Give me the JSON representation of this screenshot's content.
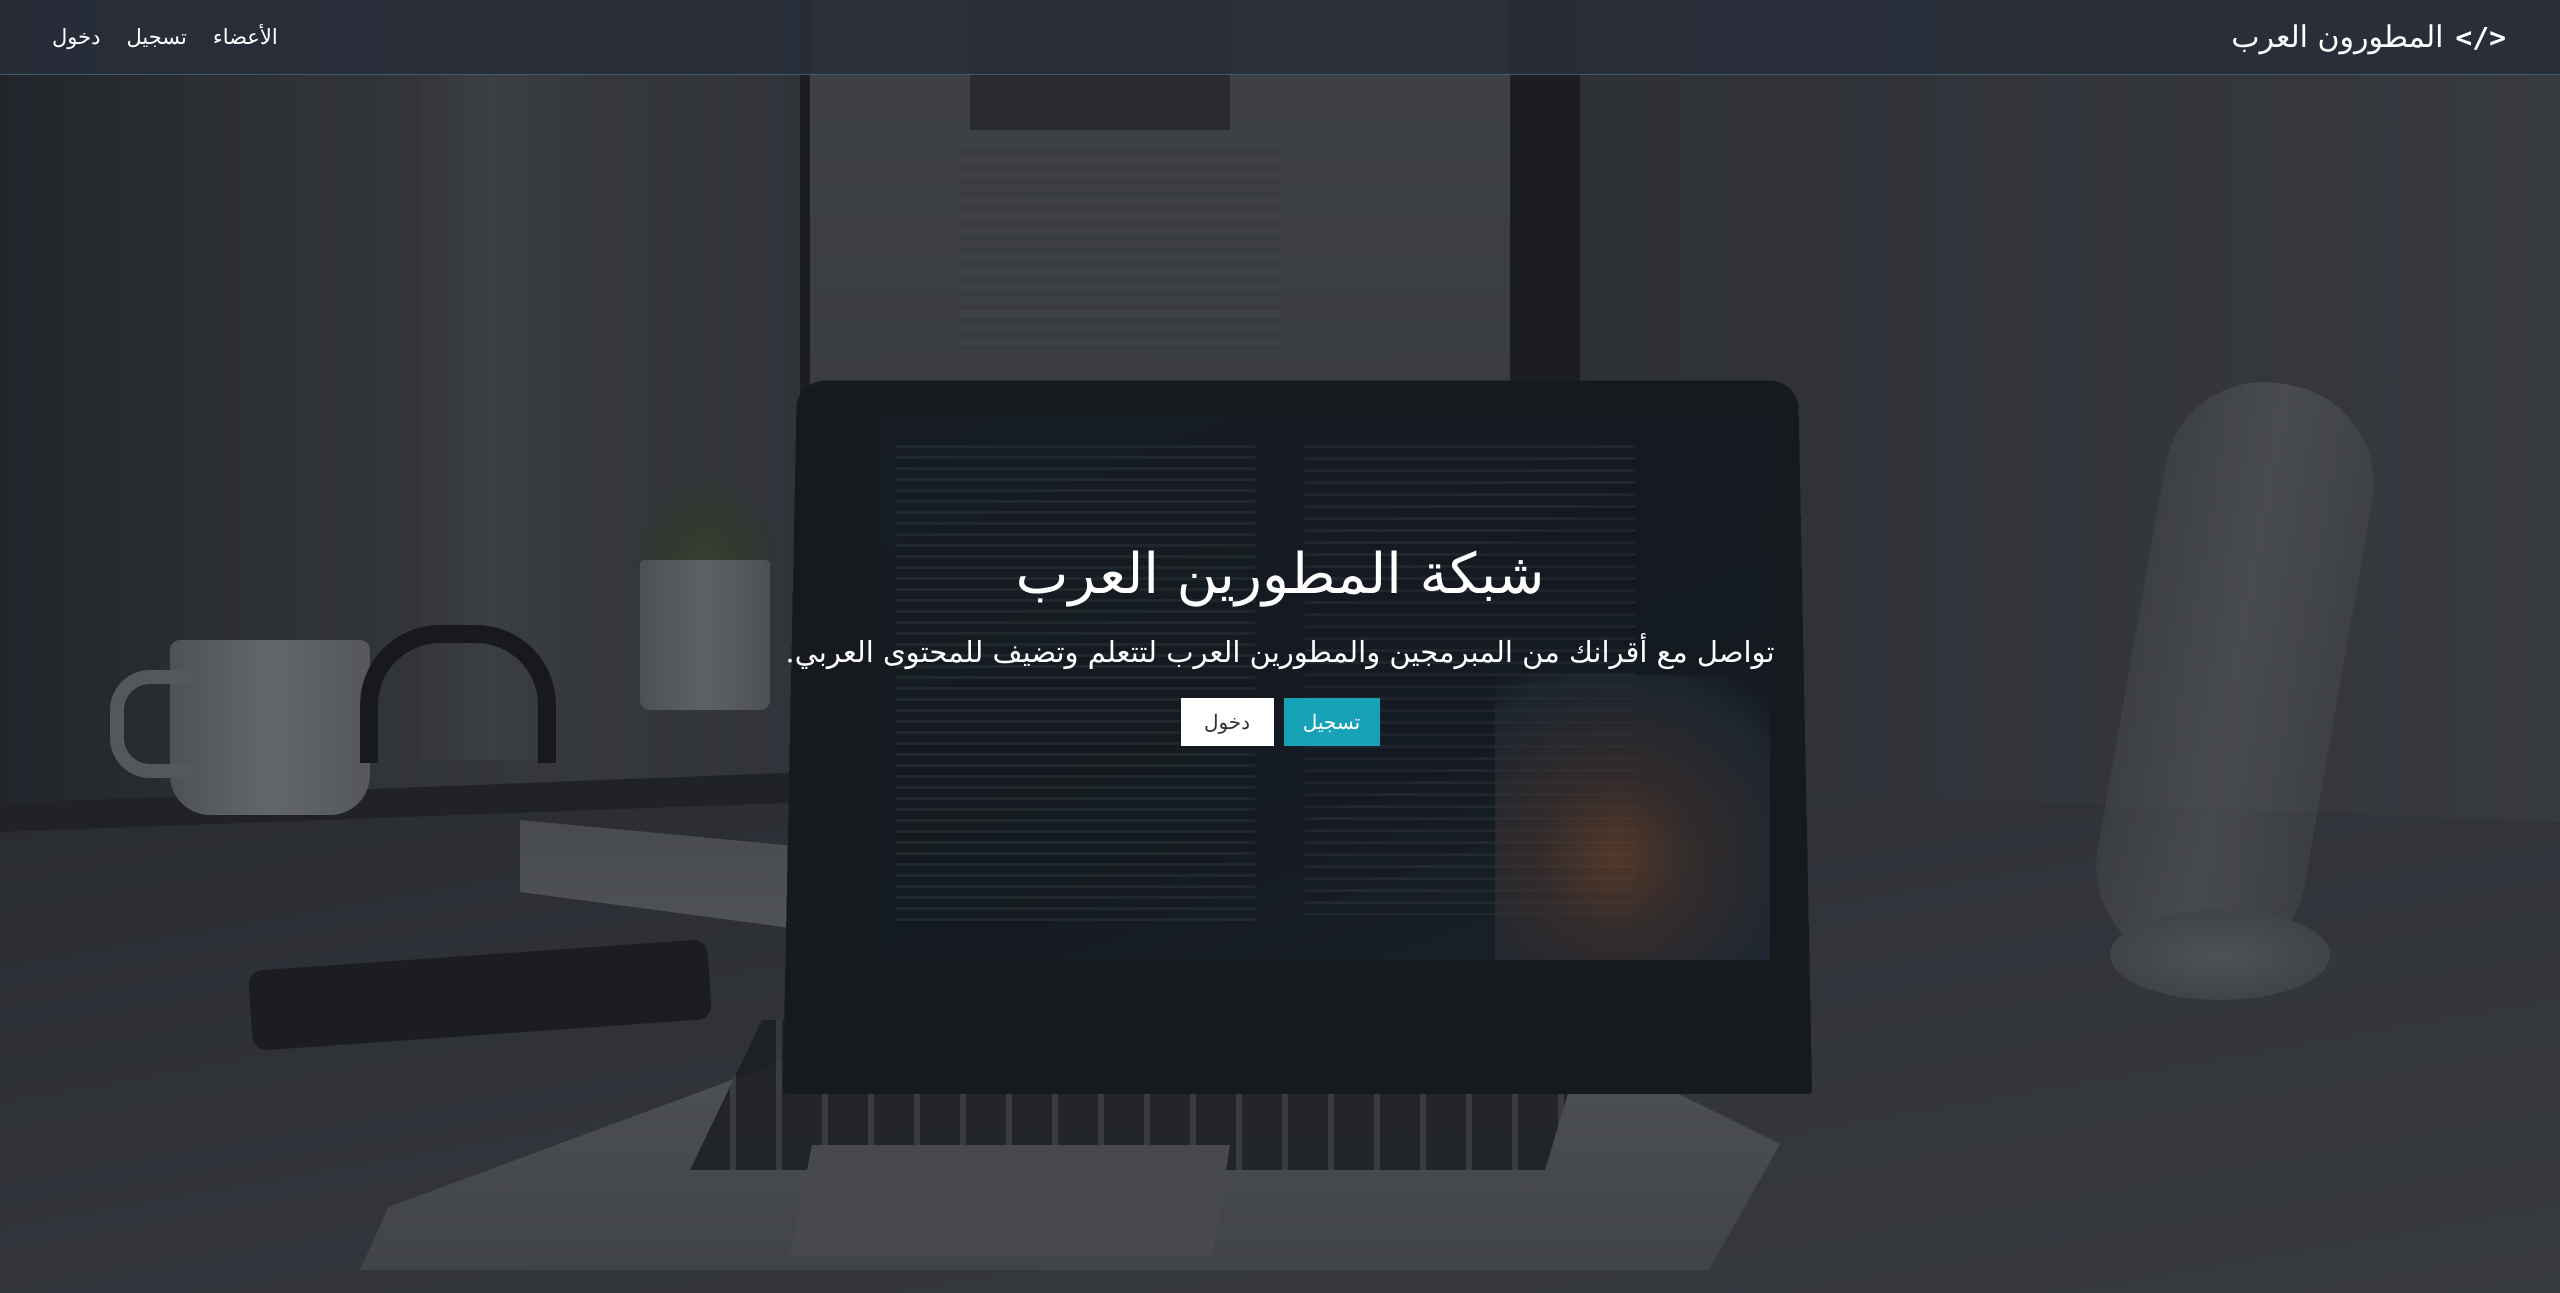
{
  "navbar": {
    "brand_icon": "</>",
    "brand_label": "المطورون العرب",
    "links": [
      {
        "label": "الأعضاء"
      },
      {
        "label": "تسجيل"
      },
      {
        "label": "دخول"
      }
    ]
  },
  "hero": {
    "title": "شبكة المطورين العرب",
    "subtitle": "تواصل مع أقرانك من المبرمجين والمطورين العرب لتتعلم وتضيف للمحتوى العربي.",
    "register_label": "تسجيل",
    "login_label": "دخول"
  },
  "colors": {
    "navbar_bg": "#282e3a",
    "accent": "#17a2b8",
    "overlay": "#1c1f26"
  }
}
